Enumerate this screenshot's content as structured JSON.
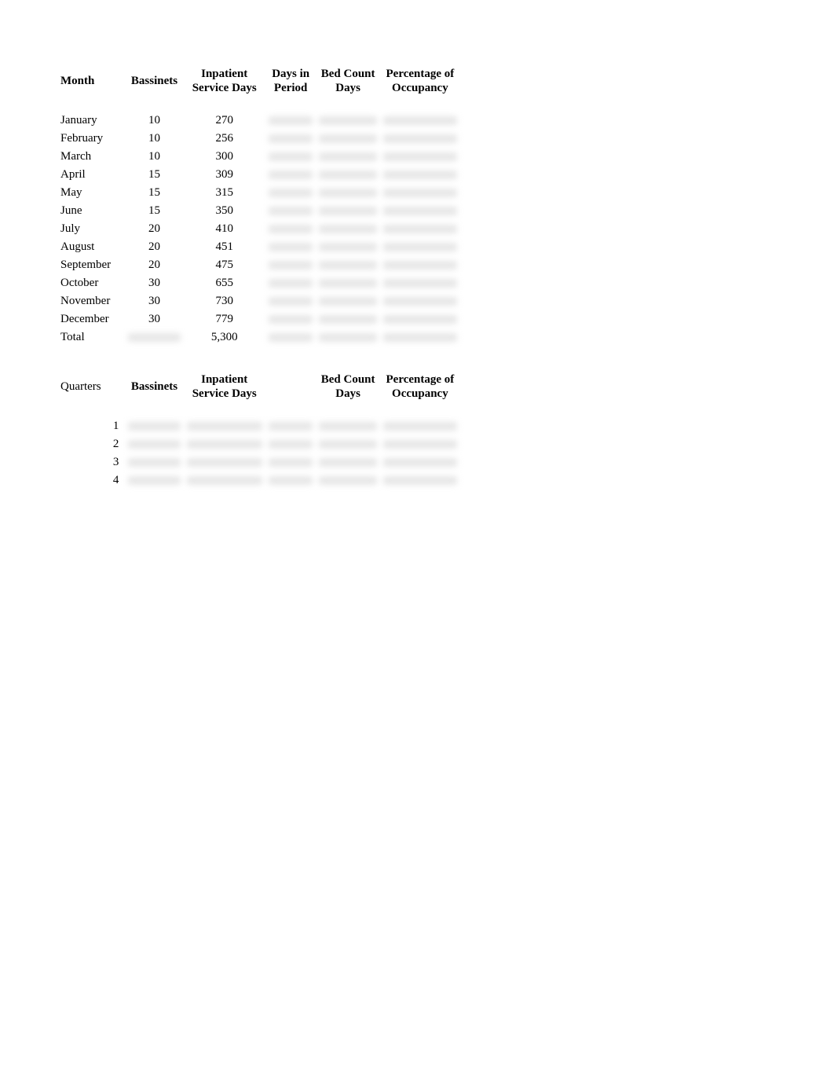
{
  "table1": {
    "headers": {
      "month": "Month",
      "bassinets": "Bassinets",
      "inpatient": "Inpatient Service Days",
      "days_period": "Days in Period",
      "bed_count": "Bed Count Days",
      "percentage": "Percentage of Occupancy"
    },
    "rows": [
      {
        "month": "January",
        "bassinets": "10",
        "inpatient": "270"
      },
      {
        "month": "February",
        "bassinets": "10",
        "inpatient": "256"
      },
      {
        "month": "March",
        "bassinets": "10",
        "inpatient": "300"
      },
      {
        "month": "April",
        "bassinets": "15",
        "inpatient": "309"
      },
      {
        "month": "May",
        "bassinets": "15",
        "inpatient": "315"
      },
      {
        "month": "June",
        "bassinets": "15",
        "inpatient": "350"
      },
      {
        "month": "July",
        "bassinets": "20",
        "inpatient": "410"
      },
      {
        "month": "August",
        "bassinets": "20",
        "inpatient": "451"
      },
      {
        "month": "September",
        "bassinets": "20",
        "inpatient": "475"
      },
      {
        "month": "October",
        "bassinets": "30",
        "inpatient": "655"
      },
      {
        "month": "November",
        "bassinets": "30",
        "inpatient": "730"
      },
      {
        "month": "December",
        "bassinets": "30",
        "inpatient": "779"
      }
    ],
    "total": {
      "label": "Total",
      "inpatient": "5,300"
    }
  },
  "table2": {
    "headers": {
      "quarters": "Quarters",
      "bassinets": "Bassinets",
      "inpatient": "Inpatient Service Days",
      "bed_count": "Bed Count Days",
      "percentage": "Percentage of Occupancy"
    },
    "rows": [
      {
        "quarter": "1"
      },
      {
        "quarter": "2"
      },
      {
        "quarter": "3"
      },
      {
        "quarter": "4"
      }
    ]
  }
}
